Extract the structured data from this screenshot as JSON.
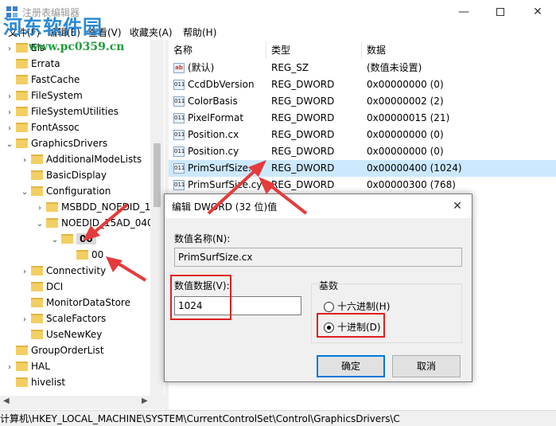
{
  "window": {
    "title": "注册表编辑器",
    "controls": {
      "minimize": "—",
      "maximize": "□",
      "close": "✕"
    }
  },
  "watermark": {
    "logo": "河东软件园",
    "url": "www.pc0359.cn"
  },
  "menu": [
    {
      "label": "文件(F)"
    },
    {
      "label": "编辑(E)"
    },
    {
      "label": "查看(V)"
    },
    {
      "label": "收藏夹(A)"
    },
    {
      "label": "帮助(H)"
    }
  ],
  "tree": [
    {
      "label": "Els",
      "chevron": "›"
    },
    {
      "label": "Errata",
      "chevron": ""
    },
    {
      "label": "FastCache",
      "chevron": ""
    },
    {
      "label": "FileSystem",
      "chevron": "›"
    },
    {
      "label": "FileSystemUtilities",
      "chevron": "›"
    },
    {
      "label": "FontAssoc",
      "chevron": "›"
    },
    {
      "label": "GraphicsDrivers",
      "chevron": "⌄"
    },
    {
      "label": "AdditionalModeLists",
      "chevron": "›"
    },
    {
      "label": "BasicDisplay",
      "chevron": ""
    },
    {
      "label": "Configuration",
      "chevron": "⌄"
    },
    {
      "label": "MSBDD_NOEDID_1",
      "chevron": "›"
    },
    {
      "label": "NOEDID_15AD_040",
      "chevron": "⌄"
    },
    {
      "label": "00",
      "chevron": "⌄",
      "selected": true
    },
    {
      "label": "00",
      "chevron": ""
    },
    {
      "label": "Connectivity",
      "chevron": "›"
    },
    {
      "label": "DCI",
      "chevron": ""
    },
    {
      "label": "MonitorDataStore",
      "chevron": ""
    },
    {
      "label": "ScaleFactors",
      "chevron": "›"
    },
    {
      "label": "UseNewKey",
      "chevron": ""
    },
    {
      "label": "GroupOrderList",
      "chevron": ""
    },
    {
      "label": "HAL",
      "chevron": "›"
    },
    {
      "label": "hivelist",
      "chevron": ""
    }
  ],
  "list": {
    "headers": {
      "name": "名称",
      "type": "类型",
      "data": "数据"
    },
    "rows": [
      {
        "icon": "ab",
        "name": "(默认)",
        "type": "REG_SZ",
        "data": "(数值未设置)"
      },
      {
        "icon": "011",
        "name": "CcdDbVersion",
        "type": "REG_DWORD",
        "data": "0x00000000 (0)"
      },
      {
        "icon": "011",
        "name": "ColorBasis",
        "type": "REG_DWORD",
        "data": "0x00000002 (2)"
      },
      {
        "icon": "011",
        "name": "PixelFormat",
        "type": "REG_DWORD",
        "data": "0x00000015 (21)"
      },
      {
        "icon": "011",
        "name": "Position.cx",
        "type": "REG_DWORD",
        "data": "0x00000000 (0)"
      },
      {
        "icon": "011",
        "name": "Position.cy",
        "type": "REG_DWORD",
        "data": "0x00000000 (0)"
      },
      {
        "icon": "011",
        "name": "PrimSurfSize.cx",
        "type": "REG_DWORD",
        "data": "0x00000400 (1024)",
        "selected": true
      },
      {
        "icon": "011",
        "name": "PrimSurfSize.cy",
        "type": "REG_DWORD",
        "data": "0x00000300 (768)"
      }
    ]
  },
  "status": {
    "path": "计算机\\HKEY_LOCAL_MACHINE\\SYSTEM\\CurrentControlSet\\Control\\GraphicsDrivers\\C"
  },
  "dialog": {
    "title": "编辑 DWORD (32 位)值",
    "close": "✕",
    "name_label": "数值名称(N):",
    "name_value": "PrimSurfSize.cx",
    "data_label": "数值数据(V):",
    "data_value": "1024",
    "base_label": "基数",
    "hex_label": "十六进制(H)",
    "dec_label": "十进制(D)",
    "base_selected": "decimal",
    "ok": "确定",
    "cancel": "取消"
  },
  "colors": {
    "highlight": "#e02020",
    "selection": "#cce8ff",
    "accent": "#0078d7"
  }
}
